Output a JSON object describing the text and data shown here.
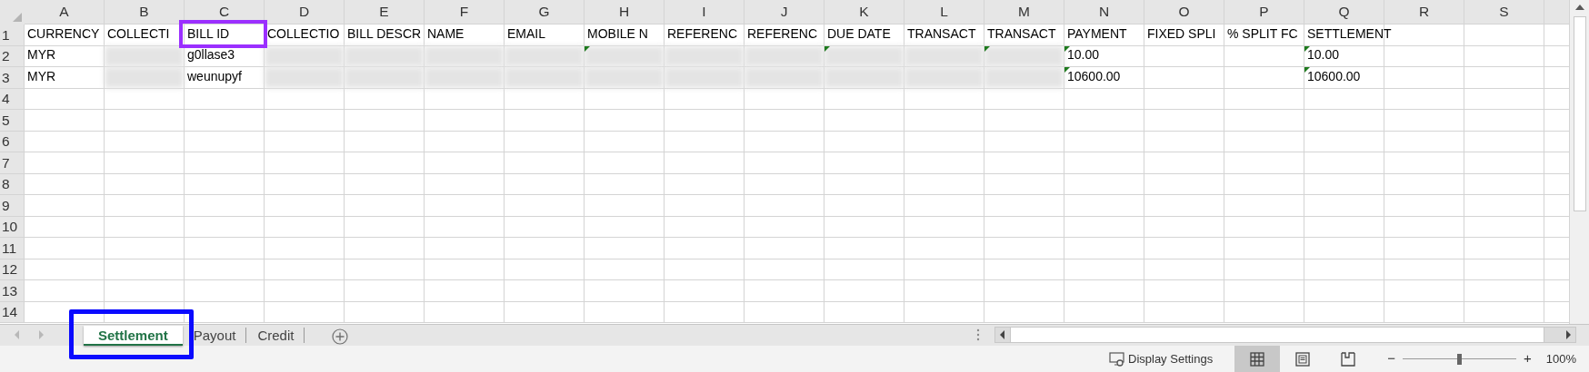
{
  "columns": [
    "A",
    "B",
    "C",
    "D",
    "E",
    "F",
    "G",
    "H",
    "I",
    "J",
    "K",
    "L",
    "M",
    "N",
    "O",
    "P",
    "Q",
    "R",
    "S"
  ],
  "rows": [
    {
      "number": "1",
      "cells": {
        "A": {
          "text": "CURRENCY"
        },
        "B": {
          "text": "COLLECTI"
        },
        "C": {
          "text": "BILL ID",
          "highlighted": true
        },
        "D": {
          "text": "COLLECTIO"
        },
        "E": {
          "text": "BILL DESCR"
        },
        "F": {
          "text": "NAME"
        },
        "G": {
          "text": "EMAIL"
        },
        "H": {
          "text": "MOBILE N"
        },
        "I": {
          "text": "REFERENC"
        },
        "J": {
          "text": "REFERENC"
        },
        "K": {
          "text": "DUE DATE"
        },
        "L": {
          "text": "TRANSACT"
        },
        "M": {
          "text": "TRANSACT"
        },
        "N": {
          "text": "PAYMENT"
        },
        "O": {
          "text": "FIXED SPLI"
        },
        "P": {
          "text": "% SPLIT FC"
        },
        "Q": {
          "text": "SETTLEMENT"
        }
      }
    },
    {
      "number": "2",
      "cells": {
        "A": {
          "text": "MYR"
        },
        "B": {
          "redacted": true
        },
        "C": {
          "text": "g0llase3"
        },
        "D": {
          "redacted": true
        },
        "E": {
          "redacted": true
        },
        "F": {
          "redacted": true
        },
        "G": {
          "redacted": true
        },
        "H": {
          "flag": true,
          "redacted": true
        },
        "I": {
          "redacted": true
        },
        "J": {
          "redacted": true
        },
        "K": {
          "flag": true,
          "redacted": true
        },
        "L": {
          "redacted": true
        },
        "M": {
          "flag": true,
          "redacted": true
        },
        "N": {
          "text": "10.00",
          "flag": true
        },
        "Q": {
          "text": "10.00",
          "flag": true
        }
      }
    },
    {
      "number": "3",
      "cells": {
        "A": {
          "text": "MYR"
        },
        "B": {
          "redacted": true
        },
        "C": {
          "text": "weunupyf"
        },
        "D": {
          "redacted": true
        },
        "E": {
          "redacted": true
        },
        "F": {
          "redacted": true
        },
        "G": {
          "redacted": true
        },
        "H": {
          "redacted": true
        },
        "I": {
          "redacted": true
        },
        "J": {
          "redacted": true
        },
        "K": {
          "redacted": true
        },
        "L": {
          "redacted": true
        },
        "M": {
          "redacted": true
        },
        "N": {
          "text": "10600.00",
          "flag": true
        },
        "Q": {
          "text": "10600.00",
          "flag": true
        }
      }
    },
    {
      "number": "4",
      "cells": {}
    },
    {
      "number": "5",
      "cells": {}
    },
    {
      "number": "6",
      "cells": {}
    },
    {
      "number": "7",
      "cells": {}
    },
    {
      "number": "8",
      "cells": {}
    },
    {
      "number": "9",
      "cells": {}
    },
    {
      "number": "10",
      "cells": {}
    },
    {
      "number": "11",
      "cells": {}
    },
    {
      "number": "12",
      "cells": {}
    },
    {
      "number": "13",
      "cells": {}
    },
    {
      "number": "14",
      "cells": {}
    }
  ],
  "sheet_tabs": [
    {
      "label": "Settlement",
      "selected": true,
      "highlighted": true
    },
    {
      "label": "Payout",
      "selected": false
    },
    {
      "label": "Credit",
      "selected": false
    }
  ],
  "status_bar": {
    "display_settings": "Display Settings",
    "views": [
      {
        "kind": "normal",
        "selected": true
      },
      {
        "kind": "page-layout",
        "selected": false
      },
      {
        "kind": "page-break",
        "selected": false
      }
    ],
    "zoom_minus": "−",
    "zoom_plus": "+",
    "zoom": {
      "level": 0.5
    },
    "zoom_text": "100%"
  }
}
